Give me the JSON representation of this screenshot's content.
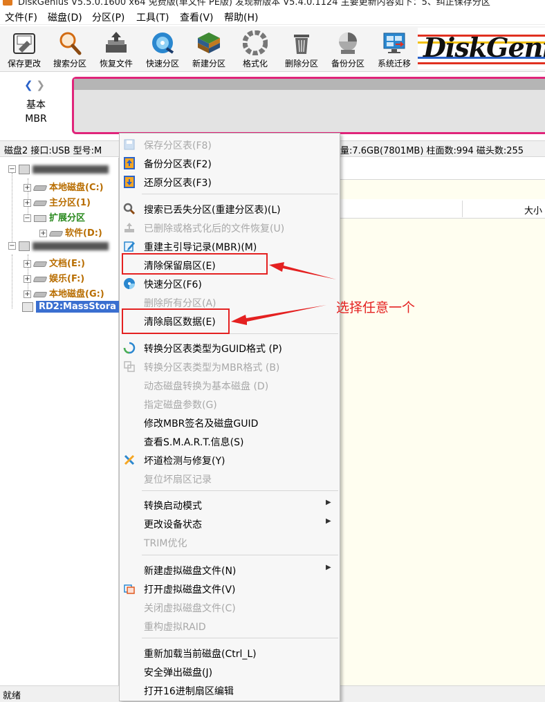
{
  "window": {
    "title": "DiskGenius V5.5.0.1600 x64 免费版(单文件 PE版) 发现新版本 V5.4.0.1124 主要更新内容如下：5、纠正保存分区"
  },
  "menubar": [
    "文件(F)",
    "磁盘(D)",
    "分区(P)",
    "工具(T)",
    "查看(V)",
    "帮助(H)"
  ],
  "toolbar": [
    {
      "label": "保存更改",
      "icon": "save-disk-icon"
    },
    {
      "label": "搜索分区",
      "icon": "magnifier-icon"
    },
    {
      "label": "恢复文件",
      "icon": "recover-files-icon"
    },
    {
      "label": "快速分区",
      "icon": "quick-partition-disc-icon"
    },
    {
      "label": "新建分区",
      "icon": "new-partition-icon"
    },
    {
      "label": "格式化",
      "icon": "format-icon"
    },
    {
      "label": "删除分区",
      "icon": "trash-icon"
    },
    {
      "label": "备份分区",
      "icon": "backup-icon"
    },
    {
      "label": "系统迁移",
      "icon": "system-migration-icon"
    }
  ],
  "logo": {
    "text": "DiskGenius"
  },
  "diskmap": {
    "type_line1": "基本",
    "type_line2": "MBR"
  },
  "diskinfo": {
    "left": "磁盘2 接口:USB  型号:M",
    "right": "量:7.6GB(7801MB)  柱面数:994  磁头数:255"
  },
  "tree": {
    "items": [
      {
        "label": "本地磁盘(C:)"
      },
      {
        "label": "主分区(1)"
      },
      {
        "label": "扩展分区"
      },
      {
        "label": "软件(D:)"
      },
      {
        "label": "文档(E:)"
      },
      {
        "label": "娱乐(F:)"
      },
      {
        "label": "本地磁盘(G:)"
      },
      {
        "label": "RD2:MassStora"
      }
    ]
  },
  "table": {
    "size_header": "大小"
  },
  "context_menu": {
    "items": [
      {
        "label": "保存分区表(F8)",
        "enabled": false
      },
      {
        "label": "备份分区表(F2)",
        "enabled": true
      },
      {
        "label": "还原分区表(F3)",
        "enabled": true
      },
      {
        "label": "搜索已丢失分区(重建分区表)(L)",
        "enabled": true
      },
      {
        "label": "已删除或格式化后的文件恢复(U)",
        "enabled": false
      },
      {
        "label": "重建主引导记录(MBR)(M)",
        "enabled": true
      },
      {
        "label": "清除保留扇区(E)",
        "enabled": true
      },
      {
        "label": "快速分区(F6)",
        "enabled": true
      },
      {
        "label": "删除所有分区(A)",
        "enabled": false
      },
      {
        "label": "清除扇区数据(E)",
        "enabled": true
      },
      {
        "label": "转换分区表类型为GUID格式 (P)",
        "enabled": true
      },
      {
        "label": "转换分区表类型为MBR格式 (B)",
        "enabled": false
      },
      {
        "label": "动态磁盘转换为基本磁盘 (D)",
        "enabled": false
      },
      {
        "label": "指定磁盘参数(G)",
        "enabled": false
      },
      {
        "label": "修改MBR签名及磁盘GUID",
        "enabled": true
      },
      {
        "label": "查看S.M.A.R.T.信息(S)",
        "enabled": true
      },
      {
        "label": "坏道检测与修复(Y)",
        "enabled": true
      },
      {
        "label": "复位坏扇区记录",
        "enabled": false
      },
      {
        "label": "转换启动模式",
        "enabled": true
      },
      {
        "label": "更改设备状态",
        "enabled": true
      },
      {
        "label": "TRIM优化",
        "enabled": false
      },
      {
        "label": "新建虚拟磁盘文件(N)",
        "enabled": true
      },
      {
        "label": "打开虚拟磁盘文件(V)",
        "enabled": true
      },
      {
        "label": "关闭虚拟磁盘文件(C)",
        "enabled": false
      },
      {
        "label": "重构虚拟RAID",
        "enabled": false
      },
      {
        "label": "重新加载当前磁盘(Ctrl_L)",
        "enabled": true
      },
      {
        "label": "安全弹出磁盘(J)",
        "enabled": true
      },
      {
        "label": "打开16进制扇区编辑",
        "enabled": true
      }
    ]
  },
  "annotation": {
    "text": "选择任意一个",
    "color": "#e42121"
  },
  "statusbar": {
    "text": "就绪"
  },
  "colors": {
    "highlight": "#e42121",
    "disk_border": "#e0247a",
    "selection": "#3a6fd0",
    "orange_partition": "#b86d00",
    "green_partition": "#2a8a1f"
  }
}
